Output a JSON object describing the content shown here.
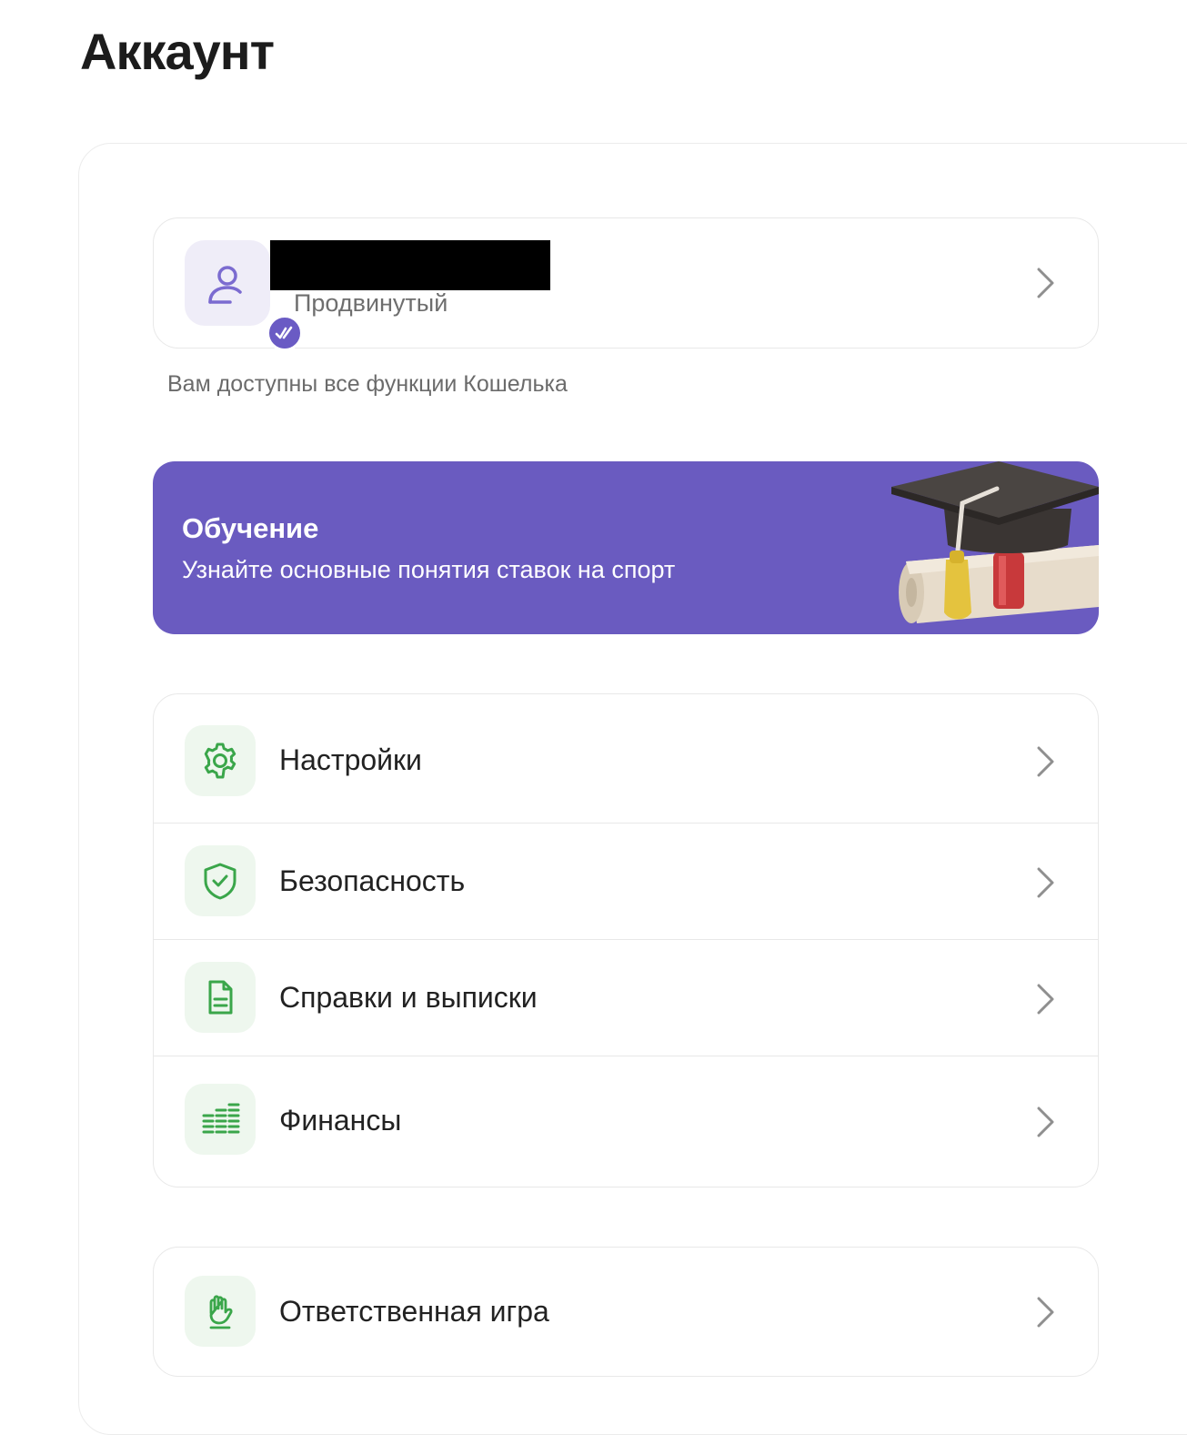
{
  "page": {
    "title": "Аккаунт"
  },
  "profile": {
    "name_redacted": "",
    "level": "Продвинутый",
    "hint": "Вам доступны все функции Кошелька"
  },
  "education_banner": {
    "title": "Обучение",
    "subtitle": "Узнайте основные понятия ставок на спорт"
  },
  "menu": {
    "items": [
      {
        "label": "Настройки",
        "icon": "gear-icon"
      },
      {
        "label": "Безопасность",
        "icon": "shield-check-icon"
      },
      {
        "label": "Справки и выписки",
        "icon": "document-icon"
      },
      {
        "label": "Финансы",
        "icon": "coins-stack-icon"
      }
    ]
  },
  "responsible_gaming": {
    "label": "Ответственная игра",
    "icon": "hand-icon"
  },
  "colors": {
    "accent_purple": "#6a5bc0",
    "icon_green": "#3aa64a",
    "icon_tile_bg": "#eef7ee",
    "avatar_bg": "#efedf8"
  }
}
